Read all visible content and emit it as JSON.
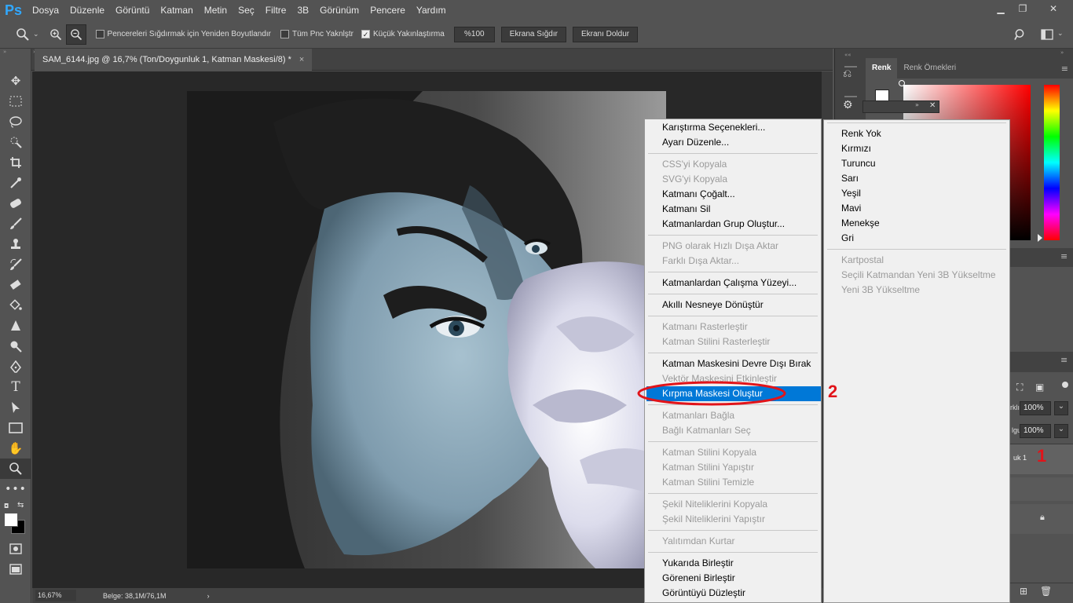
{
  "app": {
    "logo": "Ps"
  },
  "menubar": [
    "Dosya",
    "Düzenle",
    "Görüntü",
    "Katman",
    "Metin",
    "Seç",
    "Filtre",
    "3B",
    "Görünüm",
    "Pencere",
    "Yardım"
  ],
  "options": {
    "resize_windows": "Pencereleri Sığdırmak için Yeniden Boyutlandır",
    "zoom_all": "Tüm Pnc Yaknlştr",
    "scrubby_zoom": "Küçük Yakınlaştırma",
    "zoom_value": "%100",
    "fit_screen": "Ekrana Sığdır",
    "fill_screen": "Ekranı Doldur"
  },
  "document": {
    "tab_title": "SAM_6144.jpg @ 16,7% (Ton/Doygunluk 1, Katman Maskesi/8) *",
    "close": "×"
  },
  "status": {
    "zoom": "16,67%",
    "doc_info": "Belge: 38,1M/76,1M",
    "arrow": "›"
  },
  "color_panel": {
    "tab_color": "Renk",
    "tab_swatches": "Renk Örnekleri"
  },
  "layers_panel": {
    "opacity_label": "rklık:",
    "opacity": "100%",
    "fill_label": "lgu:",
    "fill": "100%",
    "layer_name": "uk 1"
  },
  "context_menu": [
    {
      "label": "Karıştırma Seçenekleri...",
      "enabled": true
    },
    {
      "label": "Ayarı Düzenle...",
      "enabled": true
    },
    {
      "sep": true
    },
    {
      "label": "CSS'yi Kopyala",
      "enabled": false
    },
    {
      "label": "SVG'yi Kopyala",
      "enabled": false
    },
    {
      "label": "Katmanı Çoğalt...",
      "enabled": true
    },
    {
      "label": "Katmanı Sil",
      "enabled": true
    },
    {
      "label": "Katmanlardan Grup Oluştur...",
      "enabled": true
    },
    {
      "sep": true
    },
    {
      "label": "PNG olarak Hızlı Dışa Aktar",
      "enabled": false
    },
    {
      "label": "Farklı Dışa Aktar...",
      "enabled": false
    },
    {
      "sep": true
    },
    {
      "label": "Katmanlardan Çalışma Yüzeyi...",
      "enabled": true
    },
    {
      "sep": true
    },
    {
      "label": "Akıllı Nesneye Dönüştür",
      "enabled": true
    },
    {
      "sep": true
    },
    {
      "label": "Katmanı Rasterleştir",
      "enabled": false
    },
    {
      "label": "Katman Stilini Rasterleştir",
      "enabled": false
    },
    {
      "sep": true
    },
    {
      "label": "Katman Maskesini Devre Dışı Bırak",
      "enabled": true
    },
    {
      "label": "Vektör Maskesini Etkinleştir",
      "enabled": false
    },
    {
      "label": "Kırpma Maskesi Oluştur",
      "enabled": true,
      "highlighted": true
    },
    {
      "sep": true
    },
    {
      "label": "Katmanları Bağla",
      "enabled": false
    },
    {
      "label": "Bağlı Katmanları Seç",
      "enabled": false
    },
    {
      "sep": true
    },
    {
      "label": "Katman Stilini Kopyala",
      "enabled": false
    },
    {
      "label": "Katman Stilini Yapıştır",
      "enabled": false
    },
    {
      "label": "Katman Stilini Temizle",
      "enabled": false
    },
    {
      "sep": true
    },
    {
      "label": "Şekil Niteliklerini Kopyala",
      "enabled": false
    },
    {
      "label": "Şekil Niteliklerini Yapıştır",
      "enabled": false
    },
    {
      "sep": true
    },
    {
      "label": "Yalıtımdan Kurtar",
      "enabled": false
    },
    {
      "sep": true
    },
    {
      "label": "Yukarıda Birleştir",
      "enabled": true
    },
    {
      "label": "Göreneni Birleştir",
      "enabled": true
    },
    {
      "label": "Görüntüyü Düzleştir",
      "enabled": true
    }
  ],
  "sub_menu": [
    {
      "sep": true
    },
    {
      "label": "Renk Yok",
      "enabled": true
    },
    {
      "label": "Kırmızı",
      "enabled": true
    },
    {
      "label": "Turuncu",
      "enabled": true
    },
    {
      "label": "Sarı",
      "enabled": true
    },
    {
      "label": "Yeşil",
      "enabled": true
    },
    {
      "label": "Mavi",
      "enabled": true
    },
    {
      "label": "Menekşe",
      "enabled": true
    },
    {
      "label": "Gri",
      "enabled": true
    },
    {
      "sep": true
    },
    {
      "label": "Kartpostal",
      "enabled": false
    },
    {
      "label": "Seçili Katmandan Yeni 3B Yükseltme",
      "enabled": false
    },
    {
      "label": "Yeni 3B Yükseltme",
      "enabled": false
    }
  ],
  "annotations": {
    "step1": "1",
    "step2": "2"
  },
  "colors": {
    "accent": "#0078d7",
    "annotation": "#e1141a"
  }
}
